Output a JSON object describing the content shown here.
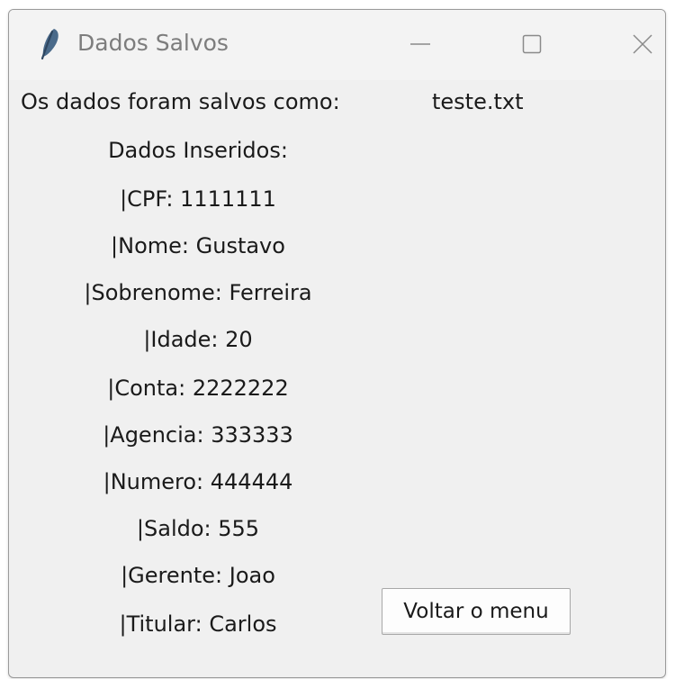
{
  "window": {
    "title": "Dados Salvos",
    "icon": "feather-icon"
  },
  "saved": {
    "label": "Os dados foram salvos como:",
    "filename": "teste.txt"
  },
  "data": {
    "heading": "Dados Inseridos:",
    "fields": [
      "|CPF: 1111111",
      "|Nome: Gustavo",
      "|Sobrenome: Ferreira",
      "|Idade: 20",
      "|Conta: 2222222",
      "|Agencia: 333333",
      "|Numero: 444444",
      "|Saldo: 555",
      "|Gerente: Joao",
      "|Titular: Carlos"
    ]
  },
  "actions": {
    "back_label": "Voltar o menu"
  }
}
